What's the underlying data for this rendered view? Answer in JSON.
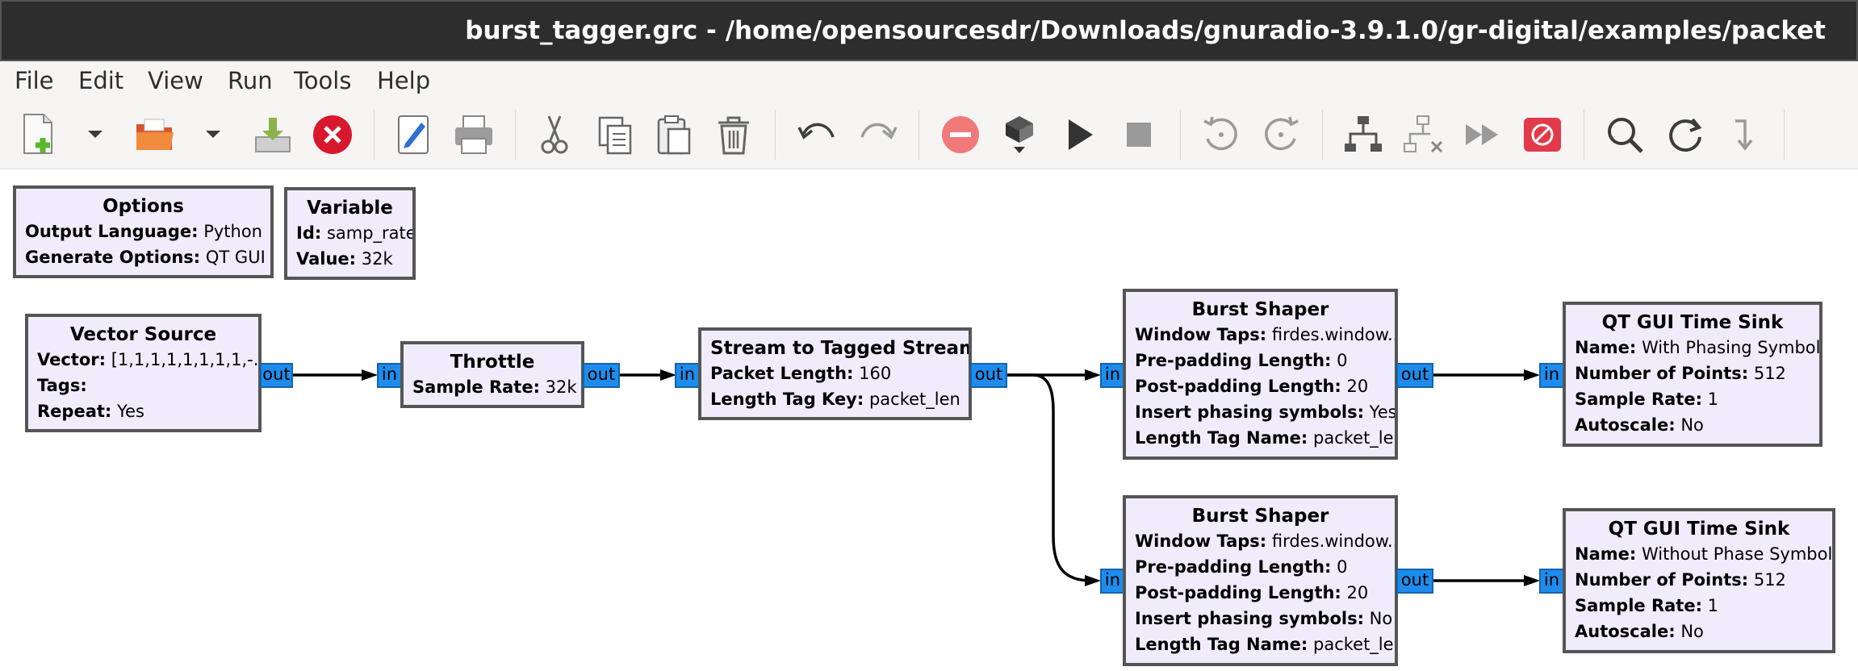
{
  "window": {
    "title": "burst_tagger.grc - /home/opensourcesdr/Downloads/gnuradio-3.9.1.0/gr-digital/examples/packet"
  },
  "menu": [
    "File",
    "Edit",
    "View",
    "Run",
    "Tools",
    "Help"
  ],
  "toolbar": [
    {
      "icon": "new-file-icon"
    },
    {
      "icon": "dropdown-arrow-icon"
    },
    {
      "icon": "open-folder-icon"
    },
    {
      "icon": "dropdown-arrow-icon"
    },
    {
      "icon": "save-icon"
    },
    {
      "icon": "close-icon"
    },
    {
      "icon": "edit-icon"
    },
    {
      "icon": "print-icon"
    },
    {
      "icon": "cut-icon"
    },
    {
      "icon": "copy-icon"
    },
    {
      "icon": "paste-icon"
    },
    {
      "icon": "delete-icon"
    },
    {
      "icon": "undo-icon"
    },
    {
      "icon": "redo-icon"
    },
    {
      "icon": "stop-flowgraph-icon"
    },
    {
      "icon": "generate-icon"
    },
    {
      "icon": "execute-icon"
    },
    {
      "icon": "kill-icon"
    },
    {
      "icon": "rotate-ccw-icon"
    },
    {
      "icon": "rotate-cw-icon"
    },
    {
      "icon": "enable-block-icon"
    },
    {
      "icon": "disable-block-icon"
    },
    {
      "icon": "bypass-icon"
    },
    {
      "icon": "block-error-icon"
    },
    {
      "icon": "find-icon"
    },
    {
      "icon": "reload-icon"
    },
    {
      "icon": "hier-block-icon"
    }
  ],
  "blocks": {
    "options": {
      "title": "Options",
      "params": [
        {
          "label": "Output Language:",
          "value": "Python"
        },
        {
          "label": "Generate Options:",
          "value": "QT GUI"
        }
      ]
    },
    "variable": {
      "title": "Variable",
      "params": [
        {
          "label": "Id:",
          "value": "samp_rate"
        },
        {
          "label": "Value:",
          "value": "32k"
        }
      ]
    },
    "vector_source": {
      "title": "Vector Source",
      "params": [
        {
          "label": "Vector:",
          "value": "[1,1,1,1,1,1,1,1,-..."
        },
        {
          "label": "Tags:",
          "value": ""
        },
        {
          "label": "Repeat:",
          "value": "Yes"
        }
      ]
    },
    "throttle": {
      "title": "Throttle",
      "params": [
        {
          "label": "Sample Rate:",
          "value": "32k"
        }
      ]
    },
    "stream_to_tagged": {
      "title": "Stream to Tagged Stream",
      "params": [
        {
          "label": "Packet Length:",
          "value": "160"
        },
        {
          "label": "Length Tag Key:",
          "value": "packet_len"
        }
      ]
    },
    "burst_shaper_1": {
      "title": "Burst Shaper",
      "params": [
        {
          "label": "Window Taps:",
          "value": "firdes.window..."
        },
        {
          "label": "Pre-padding Length:",
          "value": "0"
        },
        {
          "label": "Post-padding Length:",
          "value": "20"
        },
        {
          "label": "Insert phasing symbols:",
          "value": "Yes"
        },
        {
          "label": "Length Tag Name:",
          "value": "packet_len"
        }
      ]
    },
    "burst_shaper_2": {
      "title": "Burst Shaper",
      "params": [
        {
          "label": "Window Taps:",
          "value": "firdes.window..."
        },
        {
          "label": "Pre-padding Length:",
          "value": "0"
        },
        {
          "label": "Post-padding Length:",
          "value": "20"
        },
        {
          "label": "Insert phasing symbols:",
          "value": "No"
        },
        {
          "label": "Length Tag Name:",
          "value": "packet_len"
        }
      ]
    },
    "time_sink_1": {
      "title": "QT GUI Time Sink",
      "params": [
        {
          "label": "Name:",
          "value": "With Phasing Symbols"
        },
        {
          "label": "Number of Points:",
          "value": "512"
        },
        {
          "label": "Sample Rate:",
          "value": "1"
        },
        {
          "label": "Autoscale:",
          "value": "No"
        }
      ]
    },
    "time_sink_2": {
      "title": "QT GUI Time Sink",
      "params": [
        {
          "label": "Name:",
          "value": "Without Phase Symbols"
        },
        {
          "label": "Number of Points:",
          "value": "512"
        },
        {
          "label": "Sample Rate:",
          "value": "1"
        },
        {
          "label": "Autoscale:",
          "value": "No"
        }
      ]
    }
  },
  "ports": {
    "in": "in",
    "out": "out"
  },
  "colors": {
    "block_fill": "#f0ecfc",
    "block_border": "#555555",
    "port_fill": "#1e8ced",
    "titlebar": "#2d2d2d"
  }
}
